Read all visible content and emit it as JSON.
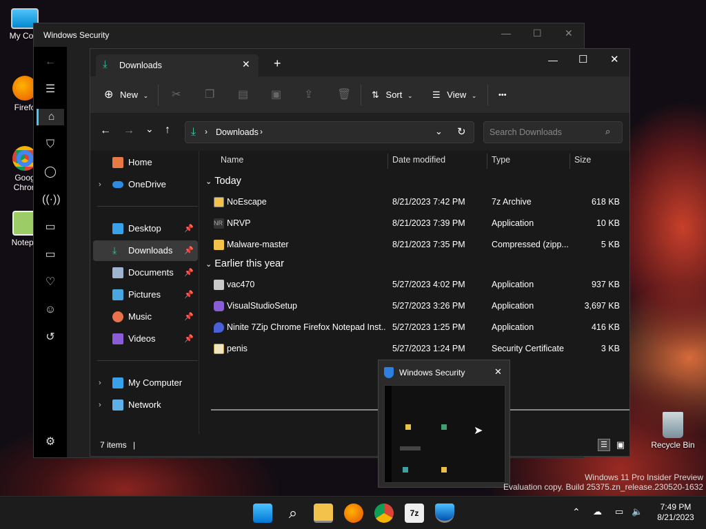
{
  "desktop": {
    "icons": [
      {
        "label": "My Com",
        "icon": "monitor-icon"
      },
      {
        "label": "Firefo",
        "icon": "firefox-icon"
      },
      {
        "label": "Goog Chron",
        "icon": "chrome-icon"
      },
      {
        "label": "Notepa",
        "icon": "notepad-icon"
      },
      {
        "label": "Recycle Bin",
        "icon": "recycle-bin-icon"
      }
    ]
  },
  "security_window": {
    "title": "Windows Security"
  },
  "explorer": {
    "tab_title": "Downloads",
    "toolbar": {
      "new_label": "New",
      "sort_label": "Sort",
      "view_label": "View",
      "more": "•••"
    },
    "address": {
      "path": "Downloads",
      "search_placeholder": "Search Downloads"
    },
    "nav": {
      "home": "Home",
      "onedrive": "OneDrive",
      "pinned": [
        "Desktop",
        "Downloads",
        "Documents",
        "Pictures",
        "Music",
        "Videos"
      ],
      "my_computer": "My Computer",
      "network": "Network"
    },
    "columns": {
      "name": "Name",
      "date": "Date modified",
      "type": "Type",
      "size": "Size"
    },
    "groups": {
      "today": "Today",
      "earlier": "Earlier this year"
    },
    "files_today": [
      {
        "name": "NoEscape",
        "date": "8/21/2023 7:42 PM",
        "type": "7z Archive",
        "size": "618 KB"
      },
      {
        "name": "NRVP",
        "date": "8/21/2023 7:39 PM",
        "type": "Application",
        "size": "10 KB"
      },
      {
        "name": "Malware-master",
        "date": "8/21/2023 7:35 PM",
        "type": "Compressed (zipp...",
        "size": "5 KB"
      }
    ],
    "files_earlier": [
      {
        "name": "vac470",
        "date": "5/27/2023 4:02 PM",
        "type": "Application",
        "size": "937 KB"
      },
      {
        "name": "VisualStudioSetup",
        "date": "5/27/2023 3:26 PM",
        "type": "Application",
        "size": "3,697 KB"
      },
      {
        "name": "Ninite 7Zip Chrome Firefox Notepad Inst...",
        "date": "5/27/2023 1:25 PM",
        "type": "Application",
        "size": "416 KB"
      },
      {
        "name": "penis",
        "date": "5/27/2023 1:24 PM",
        "type": "Security Certificate",
        "size": "3 KB"
      }
    ],
    "status": "7 items"
  },
  "thumbnail": {
    "title": "Windows Security"
  },
  "watermark": {
    "line1": "Windows 11 Pro Insider Preview",
    "line2": "Evaluation copy. Build 25375.zn_release.230520-1632"
  },
  "tray": {
    "time": "7:49 PM",
    "date": "8/21/2023"
  },
  "colors": {
    "accent": "#0078d4",
    "folder": "#f3c24a",
    "selected": "#3a3a3a"
  }
}
